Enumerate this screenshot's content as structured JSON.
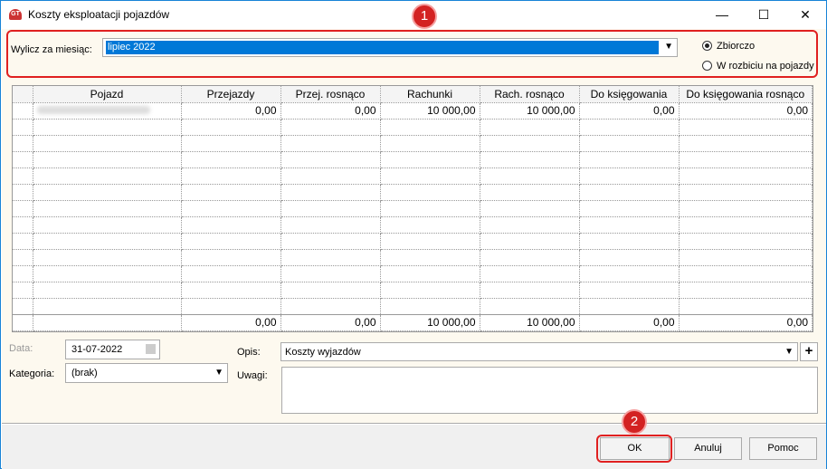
{
  "window": {
    "title": "Koszty eksploatacji pojazdów",
    "minimize": "—",
    "maximize": "☐",
    "close": "✕"
  },
  "month": {
    "label": "Wylicz za miesiąc:",
    "value": "lipiec 2022"
  },
  "mode": {
    "options": [
      {
        "label": "Zbiorczo",
        "selected": true
      },
      {
        "label": "W rozbiciu na pojazdy",
        "selected": false
      }
    ]
  },
  "table": {
    "columns": [
      "",
      "Pojazd",
      "Przejazdy",
      "Przej. rosnąco",
      "Rachunki",
      "Rach. rosnąco",
      "Do księgowania",
      "Do księgowania rosnąco"
    ],
    "rows": [
      [
        "",
        "",
        "0,00",
        "0,00",
        "10 000,00",
        "10 000,00",
        "0,00",
        "0,00"
      ]
    ],
    "empty_rows": 12,
    "totals": [
      "",
      "",
      "0,00",
      "0,00",
      "10 000,00",
      "10 000,00",
      "0,00",
      "0,00"
    ]
  },
  "form": {
    "date_label": "Data:",
    "date_value": "31-07-2022",
    "category_label": "Kategoria:",
    "category_value": "(brak)",
    "opis_label": "Opis:",
    "opis_value": "Koszty wyjazdów",
    "uwagi_label": "Uwagi:",
    "uwagi_value": "",
    "add": "+"
  },
  "buttons": {
    "ok": "OK",
    "cancel": "Anuluj",
    "help": "Pomoc"
  },
  "annotations": [
    "1",
    "2"
  ],
  "colors": {
    "highlight": "#e02020",
    "selection": "#0078d7",
    "border": "#1883d7"
  }
}
